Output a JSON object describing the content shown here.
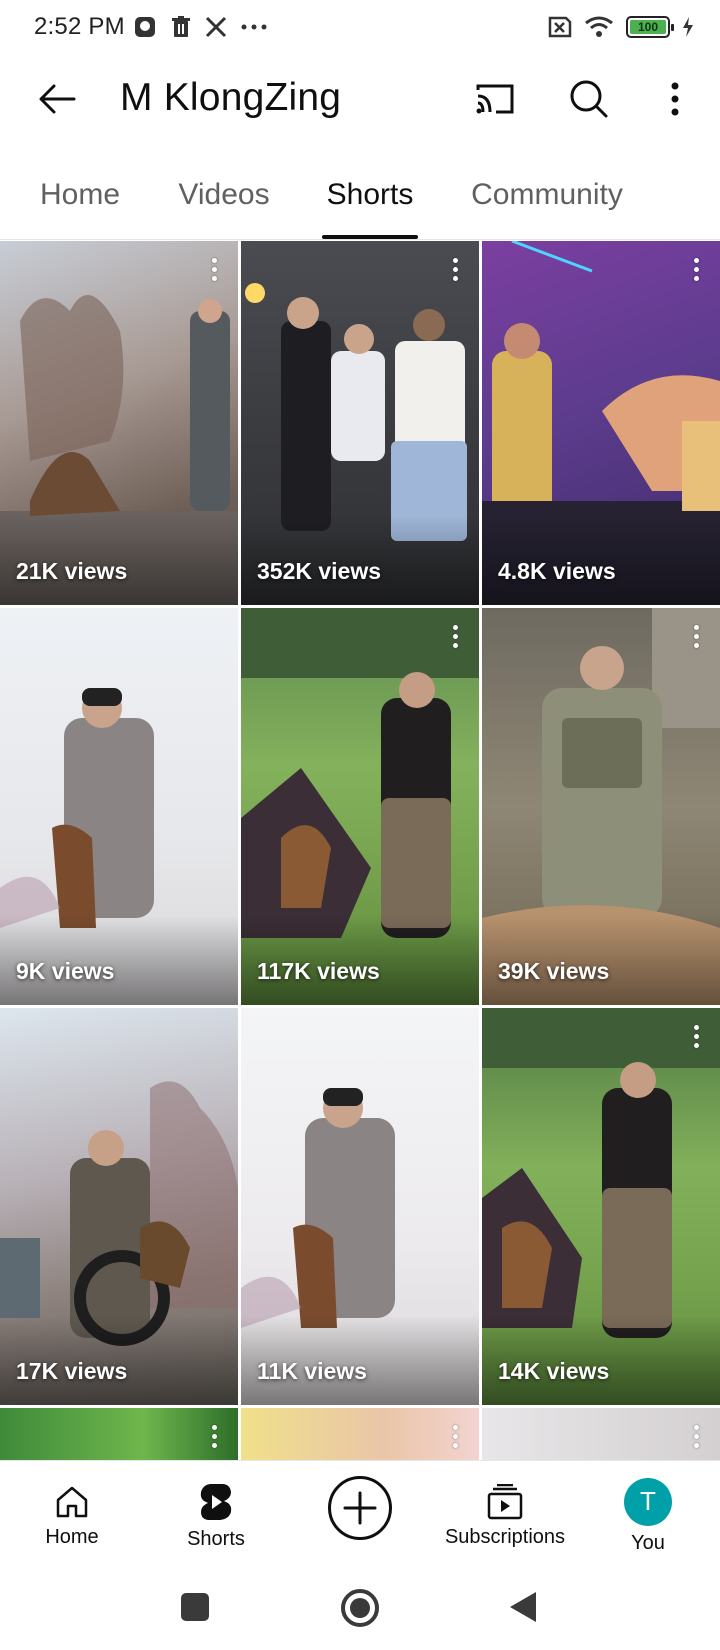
{
  "status_bar": {
    "time": "2:52 PM",
    "battery": "100"
  },
  "app_bar": {
    "title": "M KlongZing",
    "icons": [
      "back-arrow-icon",
      "cast-icon",
      "search-icon",
      "more-vert-icon"
    ]
  },
  "tabs": [
    {
      "label": "Home",
      "active": false
    },
    {
      "label": "Videos",
      "active": false
    },
    {
      "label": "Shorts",
      "active": true
    },
    {
      "label": "Community",
      "active": false
    }
  ],
  "shorts": [
    {
      "views": "21K views"
    },
    {
      "views": "352K views"
    },
    {
      "views": "4.8K views"
    },
    {
      "views": "9K views"
    },
    {
      "views": "117K views"
    },
    {
      "views": "39K views"
    },
    {
      "views": "17K views"
    },
    {
      "views": "11K views"
    },
    {
      "views": "14K views"
    }
  ],
  "bottom_nav": {
    "home": "Home",
    "shorts": "Shorts",
    "subscriptions": "Subscriptions",
    "you": "You",
    "avatar_letter": "T"
  },
  "colors": {
    "accent_avatar": "#00a0a8",
    "battery_fill": "#4caf50",
    "text_primary": "#0f0f0f",
    "text_secondary": "#606060"
  }
}
